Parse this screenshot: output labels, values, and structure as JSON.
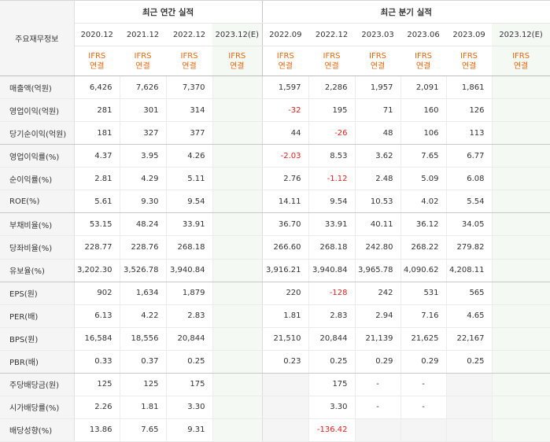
{
  "header": {
    "label": "주요재무정보",
    "annual_group": "최근 연간 실적",
    "quarter_group": "최근 분기 실적",
    "annual_periods": [
      "2020.12",
      "2021.12",
      "2022.12",
      "2023.12(E)"
    ],
    "quarter_periods": [
      "2022.09",
      "2022.12",
      "2023.03",
      "2023.06",
      "2023.09",
      "2023.12(E)"
    ],
    "ifrs_line1": "IFRS",
    "ifrs_line2": "연결"
  },
  "rows": [
    {
      "label": "매출액(억원)",
      "annual": [
        "6,426",
        "7,626",
        "7,370",
        ""
      ],
      "quarter": [
        "1,597",
        "2,286",
        "1,957",
        "2,091",
        "1,861",
        ""
      ]
    },
    {
      "label": "영업이익(억원)",
      "annual": [
        "281",
        "301",
        "314",
        ""
      ],
      "quarter": [
        "-32",
        "195",
        "71",
        "160",
        "126",
        ""
      ]
    },
    {
      "label": "당기순이익(억원)",
      "annual": [
        "181",
        "327",
        "377",
        ""
      ],
      "quarter": [
        "44",
        "-26",
        "48",
        "106",
        "113",
        ""
      ]
    },
    {
      "label": "영업이익률(%)",
      "annual": [
        "4.37",
        "3.95",
        "4.26",
        ""
      ],
      "quarter": [
        "-2.03",
        "8.53",
        "3.62",
        "7.65",
        "6.77",
        ""
      ]
    },
    {
      "label": "순이익률(%)",
      "annual": [
        "2.81",
        "4.29",
        "5.11",
        ""
      ],
      "quarter": [
        "2.76",
        "-1.12",
        "2.48",
        "5.09",
        "6.08",
        ""
      ]
    },
    {
      "label": "ROE(%)",
      "annual": [
        "5.61",
        "9.30",
        "9.54",
        ""
      ],
      "quarter": [
        "14.11",
        "9.54",
        "10.53",
        "4.02",
        "5.54",
        ""
      ]
    },
    {
      "label": "부채비율(%)",
      "annual": [
        "53.15",
        "48.24",
        "33.91",
        ""
      ],
      "quarter": [
        "36.70",
        "33.91",
        "40.11",
        "36.12",
        "34.05",
        ""
      ]
    },
    {
      "label": "당좌비율(%)",
      "annual": [
        "228.77",
        "228.76",
        "268.18",
        ""
      ],
      "quarter": [
        "266.60",
        "268.18",
        "242.80",
        "268.22",
        "279.82",
        ""
      ]
    },
    {
      "label": "유보율(%)",
      "annual": [
        "3,202.30",
        "3,526.78",
        "3,940.84",
        ""
      ],
      "quarter": [
        "3,916.21",
        "3,940.84",
        "3,965.78",
        "4,090.62",
        "4,208.11",
        ""
      ]
    },
    {
      "label": "EPS(원)",
      "annual": [
        "902",
        "1,634",
        "1,879",
        ""
      ],
      "quarter": [
        "220",
        "-128",
        "242",
        "531",
        "565",
        ""
      ]
    },
    {
      "label": "PER(배)",
      "annual": [
        "6.13",
        "4.22",
        "2.83",
        ""
      ],
      "quarter": [
        "1.81",
        "2.83",
        "2.94",
        "7.16",
        "4.65",
        ""
      ]
    },
    {
      "label": "BPS(원)",
      "annual": [
        "16,584",
        "18,556",
        "20,844",
        ""
      ],
      "quarter": [
        "21,510",
        "20,844",
        "21,139",
        "21,625",
        "22,167",
        ""
      ]
    },
    {
      "label": "PBR(배)",
      "annual": [
        "0.33",
        "0.37",
        "0.25",
        ""
      ],
      "quarter": [
        "0.23",
        "0.25",
        "0.29",
        "0.29",
        "0.25",
        ""
      ]
    },
    {
      "label": "주당배당금(원)",
      "annual": [
        "125",
        "125",
        "175",
        ""
      ],
      "quarter": [
        "",
        "175",
        "-",
        "-",
        "",
        ""
      ]
    },
    {
      "label": "시가배당률(%)",
      "annual": [
        "2.26",
        "1.81",
        "3.30",
        ""
      ],
      "quarter": [
        "",
        "3.30",
        "-",
        "-",
        "",
        ""
      ]
    },
    {
      "label": "배당성향(%)",
      "annual": [
        "13.86",
        "7.65",
        "9.31",
        ""
      ],
      "quarter": [
        "",
        "-136.42",
        "",
        "",
        "",
        ""
      ]
    }
  ],
  "colors": {
    "ifrs_text": "#e8670e",
    "negative": "#e02020",
    "label_bg": "#f5f5f5",
    "estimate_bg": "#f4f9f4"
  }
}
